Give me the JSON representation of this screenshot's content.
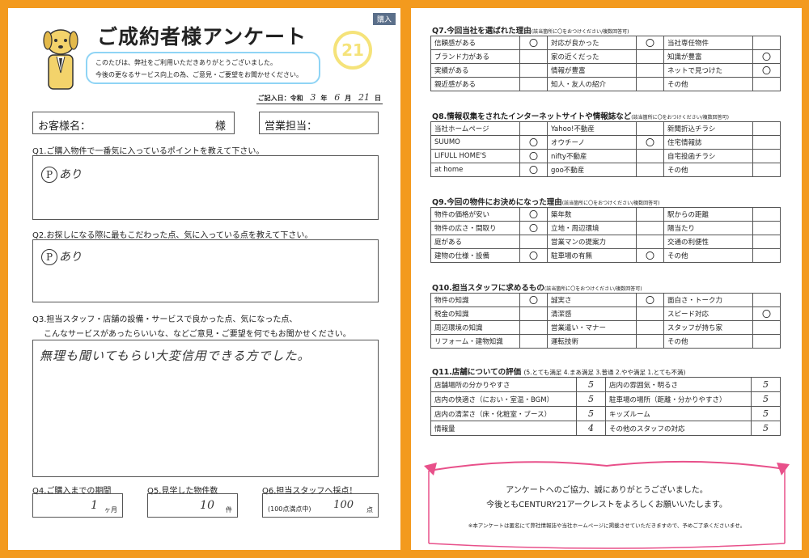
{
  "left": {
    "tag": "購入",
    "title": "ご成約者様アンケート",
    "logo_text": "21",
    "greeting": [
      "このたびは、弊社をご利用いただきありがとうございました。",
      "今後の更なるサービス向上の為、ご意見・ご要望をお聞かせください。"
    ],
    "date": {
      "label": "ご記入日：令和",
      "year": "3",
      "year_unit": "年",
      "month": "6",
      "month_unit": "月",
      "day": "21",
      "day_unit": "日"
    },
    "customer": {
      "label": "お客様名：",
      "suffix": "様"
    },
    "staff": {
      "label": "営業担当："
    },
    "q1": {
      "label": "Q1.ご購入物件で一番気に入っているポイントを教えて下さい。",
      "answer": "あり",
      "mark": "P"
    },
    "q2": {
      "label": "Q2.お探しになる際に最もこだわった点、気に入っている点を教えて下さい。",
      "answer": "あり",
      "mark": "P"
    },
    "q3": {
      "label1": "Q3.担当スタッフ・店舗の設備・サービスで良かった点、気になった点、",
      "label2": "こんなサービスがあったらいいな、などご意見・ご要望を何でもお聞かせください。",
      "answer": "無理も聞いてもらい大変信用できる方でした。"
    },
    "q4": {
      "label": "Q4.ご購入までの期間",
      "value": "1",
      "unit": "ヶ月"
    },
    "q5": {
      "label": "Q5.見学した物件数",
      "value": "10",
      "unit": "件"
    },
    "q6": {
      "label": "Q6.担当スタッフへ採点！",
      "prefix": "(100点満点中)",
      "value": "100",
      "unit": "点"
    }
  },
  "right": {
    "q7": {
      "label": "Q7.今回当社を選ばれた理由",
      "note": "(該当箇所に〇をおつけください/複数回答可)",
      "rows": [
        [
          {
            "t": "信頼感がある",
            "m": "〇"
          },
          {
            "t": "対応が良かった",
            "m": "〇"
          },
          {
            "t": "当社専任物件",
            "m": ""
          }
        ],
        [
          {
            "t": "ブランド力がある",
            "m": ""
          },
          {
            "t": "家の近くだった",
            "m": ""
          },
          {
            "t": "知識が豊富",
            "m": "〇"
          }
        ],
        [
          {
            "t": "実績がある",
            "m": ""
          },
          {
            "t": "情報が豊富",
            "m": ""
          },
          {
            "t": "ネットで見つけた",
            "m": "〇"
          }
        ],
        [
          {
            "t": "親近感がある",
            "m": ""
          },
          {
            "t": "知人・友人の紹介",
            "m": ""
          },
          {
            "t": "その他",
            "m": ""
          }
        ]
      ]
    },
    "q8": {
      "label": "Q8.情報収集をされたインターネットサイトや情報誌など",
      "note": "(該当箇所に〇をおつけください/複数回答可)",
      "rows": [
        [
          {
            "t": "当社ホームページ",
            "m": ""
          },
          {
            "t": "Yahoo!不動産",
            "m": ""
          },
          {
            "t": "新聞折込チラシ",
            "m": ""
          }
        ],
        [
          {
            "t": "SUUMO",
            "m": "〇"
          },
          {
            "t": "オウチーノ",
            "m": "〇"
          },
          {
            "t": "住宅情報誌",
            "m": ""
          }
        ],
        [
          {
            "t": "LIFULL HOME'S",
            "m": "〇"
          },
          {
            "t": "nifty不動産",
            "m": ""
          },
          {
            "t": "自宅投函チラシ",
            "m": ""
          }
        ],
        [
          {
            "t": "at home",
            "m": "〇"
          },
          {
            "t": "goo不動産",
            "m": ""
          },
          {
            "t": "その他",
            "m": ""
          }
        ]
      ]
    },
    "q9": {
      "label": "Q9.今回の物件にお決めになった理由",
      "note": "(該当箇所に〇をおつけください/複数回答可)",
      "rows": [
        [
          {
            "t": "物件の価格が安い",
            "m": "〇"
          },
          {
            "t": "築年数",
            "m": ""
          },
          {
            "t": "駅からの距離",
            "m": ""
          }
        ],
        [
          {
            "t": "物件の広さ・間取り",
            "m": "〇"
          },
          {
            "t": "立地・周辺環境",
            "m": ""
          },
          {
            "t": "陽当たり",
            "m": ""
          }
        ],
        [
          {
            "t": "庭がある",
            "m": ""
          },
          {
            "t": "営業マンの提案力",
            "m": ""
          },
          {
            "t": "交通の利便性",
            "m": ""
          }
        ],
        [
          {
            "t": "建物の仕様・設備",
            "m": "〇"
          },
          {
            "t": "駐車場の有無",
            "m": "〇"
          },
          {
            "t": "その他",
            "m": ""
          }
        ]
      ]
    },
    "q10": {
      "label": "Q10.担当スタッフに求めるもの",
      "note": "(該当箇所に〇をおつけください/複数回答可)",
      "rows": [
        [
          {
            "t": "物件の知識",
            "m": "〇"
          },
          {
            "t": "誠実さ",
            "m": "〇"
          },
          {
            "t": "面白さ・トーク力",
            "m": ""
          }
        ],
        [
          {
            "t": "税金の知識",
            "m": ""
          },
          {
            "t": "清潔感",
            "m": ""
          },
          {
            "t": "スピード対応",
            "m": "〇"
          }
        ],
        [
          {
            "t": "周辺環境の知識",
            "m": ""
          },
          {
            "t": "営業遣い・マナー",
            "m": ""
          },
          {
            "t": "スタッフが持ち家",
            "m": ""
          }
        ],
        [
          {
            "t": "リフォーム・建物知識",
            "m": ""
          },
          {
            "t": "運転技術",
            "m": ""
          },
          {
            "t": "その他",
            "m": ""
          }
        ]
      ]
    },
    "q11": {
      "label": "Q11.店舗についての評価",
      "scale": "(5.とても満足 4.まあ満足 3.普通 2.やや満足 1.とても不満)",
      "rows": [
        [
          {
            "t": "店舗場所の分かりやすさ",
            "m": "5"
          },
          {
            "t": "店内の雰囲気・明るさ",
            "m": "5"
          }
        ],
        [
          {
            "t": "店内の快適さ（におい・室温・BGM）",
            "m": "5"
          },
          {
            "t": "駐車場の場所（距離・分かりやすさ）",
            "m": "5"
          }
        ],
        [
          {
            "t": "店内の清潔さ（床・化粧室・ブース）",
            "m": "5"
          },
          {
            "t": "キッズルーム",
            "m": "5"
          }
        ],
        [
          {
            "t": "情報量",
            "m": "4"
          },
          {
            "t": "その他のスタッフの対応",
            "m": "5"
          }
        ]
      ]
    },
    "thanks": {
      "line1": "アンケートへのご協力、誠にありがとうございました。",
      "line2": "今後ともCENTURY21アークレストをよろしくお願いいたします。",
      "note": "※本アンケートは匿名にて弊社情報誌や当社ホームページに掲載させていただきますので、予めご了承くださいませ。"
    }
  }
}
